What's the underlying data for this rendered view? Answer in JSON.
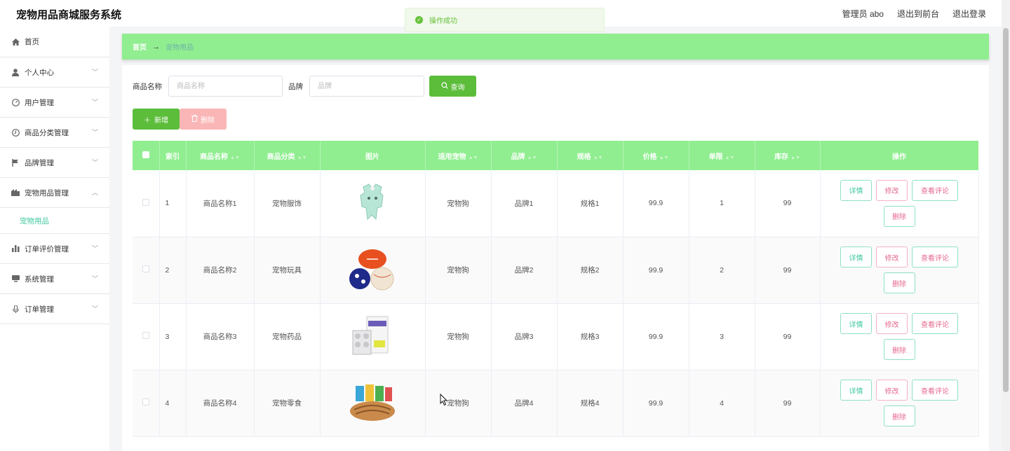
{
  "header": {
    "app_title": "宠物用品商城服务系统",
    "admin_label": "管理员 abo",
    "to_front_label": "退出到前台",
    "logout_label": "退出登录"
  },
  "toast": {
    "message": "操作成功"
  },
  "sidebar": {
    "items": [
      {
        "label": "首页",
        "icon": "home-icon",
        "has_arrow": false
      },
      {
        "label": "个人中心",
        "icon": "user-icon",
        "has_arrow": true
      },
      {
        "label": "用户管理",
        "icon": "gauge-icon",
        "has_arrow": true
      },
      {
        "label": "商品分类管理",
        "icon": "clock-icon",
        "has_arrow": true
      },
      {
        "label": "品牌管理",
        "icon": "flag-icon",
        "has_arrow": true
      },
      {
        "label": "宠物用品管理",
        "icon": "shop-icon",
        "has_arrow": true,
        "expanded": true
      },
      {
        "label": "订单评价管理",
        "icon": "bar-chart-icon",
        "has_arrow": true
      },
      {
        "label": "系统管理",
        "icon": "monitor-icon",
        "has_arrow": true
      },
      {
        "label": "订单管理",
        "icon": "mic-icon",
        "has_arrow": true
      }
    ],
    "submenu_active": "宠物用品"
  },
  "breadcrumb": {
    "home": "首页",
    "separator": "→",
    "current": "宠物用品"
  },
  "search": {
    "name_label": "商品名称",
    "name_placeholder": "商品名称",
    "brand_label": "品牌",
    "brand_placeholder": "品牌",
    "query_label": "查询"
  },
  "actions": {
    "add_label": "新增",
    "delete_label": "删除"
  },
  "table": {
    "headers": [
      "索引",
      "商品名称",
      "商品分类",
      "图片",
      "适用宠物",
      "品牌",
      "规格",
      "价格",
      "单限",
      "库存",
      "操作"
    ],
    "op_labels": {
      "detail": "详情",
      "edit": "修改",
      "comment": "查看评论",
      "remove": "删除"
    },
    "rows": [
      {
        "index": "1",
        "name": "商品名称1",
        "category": "宠物服饰",
        "pet": "宠物狗",
        "brand": "品牌1",
        "spec": "规格1",
        "price": "99.9",
        "limit": "1",
        "stock": "99"
      },
      {
        "index": "2",
        "name": "商品名称2",
        "category": "宠物玩具",
        "pet": "宠物狗",
        "brand": "品牌2",
        "spec": "规格2",
        "price": "99.9",
        "limit": "2",
        "stock": "99"
      },
      {
        "index": "3",
        "name": "商品名称3",
        "category": "宠物药品",
        "pet": "宠物狗",
        "brand": "品牌3",
        "spec": "规格3",
        "price": "99.9",
        "limit": "3",
        "stock": "99"
      },
      {
        "index": "4",
        "name": "商品名称4",
        "category": "宠物零食",
        "pet": "宠物狗",
        "brand": "品牌4",
        "spec": "规格4",
        "price": "99.9",
        "limit": "4",
        "stock": "99"
      }
    ]
  },
  "colors": {
    "accent_green": "#90ee90",
    "button_green": "#5cbd3b",
    "submenu_teal": "#3fc8a0",
    "danger_pink": "#e66a8f"
  }
}
